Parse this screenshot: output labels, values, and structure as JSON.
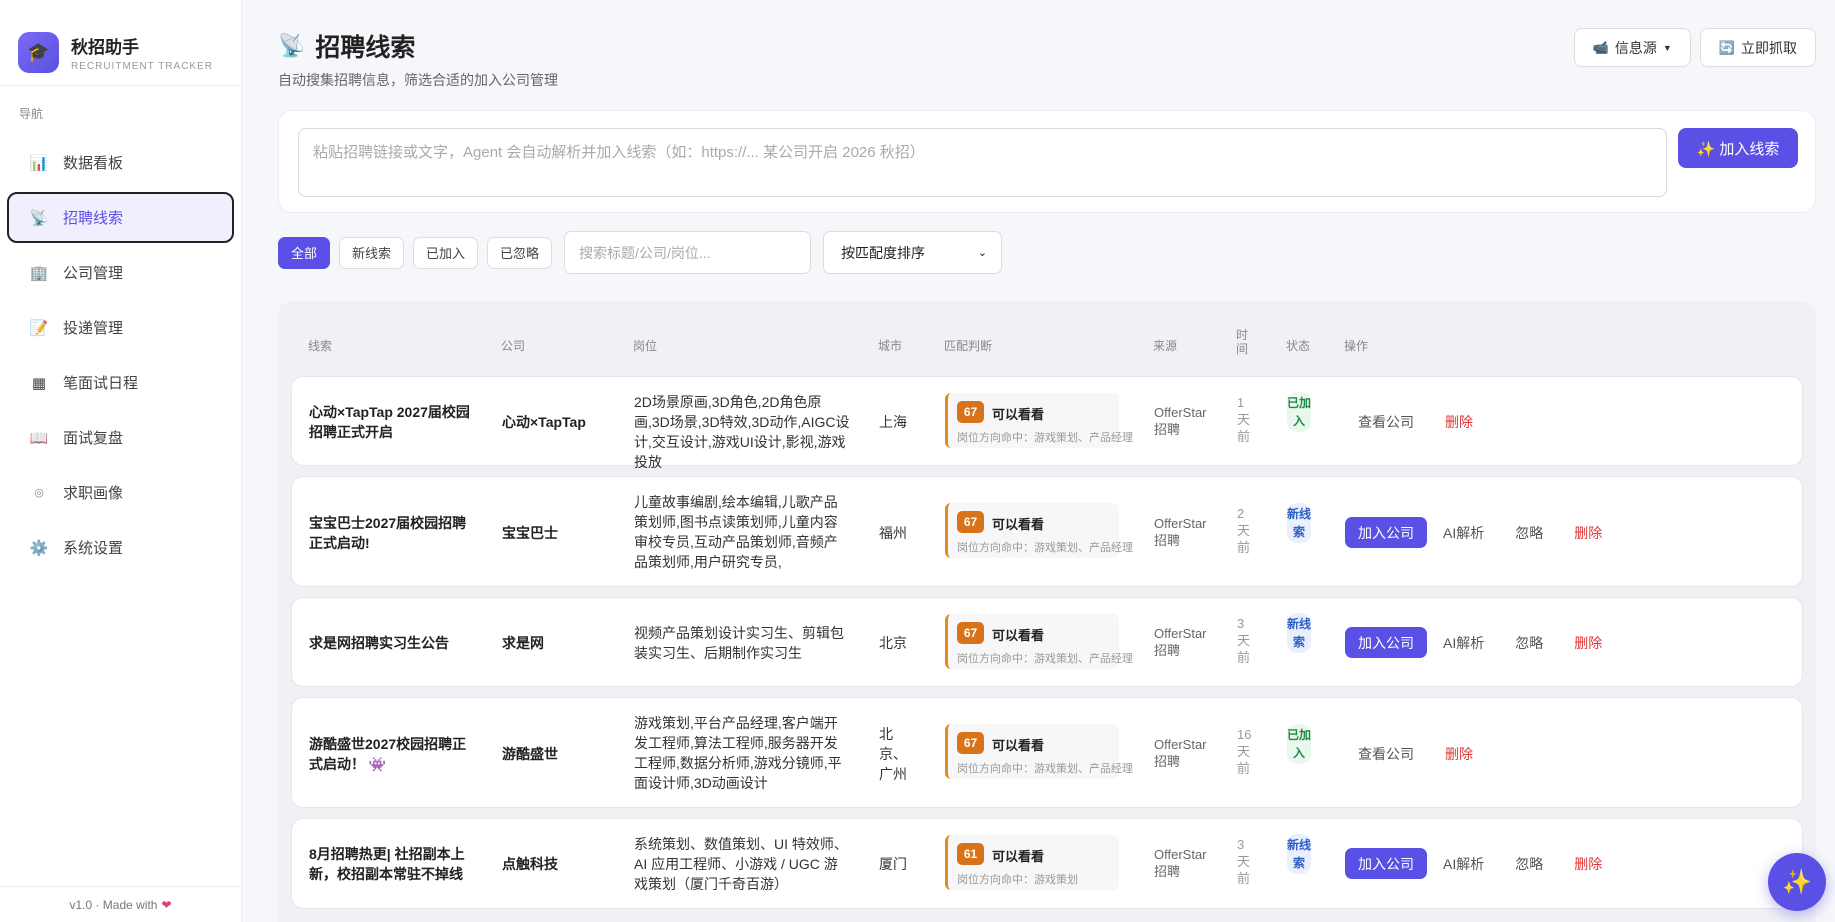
{
  "brand": {
    "title": "秋招助手",
    "subtitle": "RECRUITMENT TRACKER"
  },
  "sidebar": {
    "nav_label": "导航",
    "items": [
      {
        "label": "数据看板",
        "icon": "chart-icon"
      },
      {
        "label": "招聘线索",
        "icon": "satellite-icon",
        "active": true
      },
      {
        "label": "公司管理",
        "icon": "building-icon"
      },
      {
        "label": "投递管理",
        "icon": "memo-icon"
      },
      {
        "label": "笔面试日程",
        "icon": "calendar-grid-icon"
      },
      {
        "label": "面试复盘",
        "icon": "book-icon"
      },
      {
        "label": "求职画像",
        "icon": "target-icon"
      },
      {
        "label": "系统设置",
        "icon": "gear-icon"
      }
    ],
    "footer": "v1.0 · Made with"
  },
  "header": {
    "title": "招聘线索",
    "subtitle": "自动搜集招聘信息，筛选合适的加入公司管理",
    "source_btn": "信息源",
    "fetch_btn": "立即抓取"
  },
  "input": {
    "placeholder": "粘贴招聘链接或文字，Agent 会自动解析并加入线索（如：https://... 某公司开启 2026 秋招）",
    "add_btn": "✨ 加入线索"
  },
  "filters": {
    "chips": [
      "全部",
      "新线索",
      "已加入",
      "已忽略"
    ],
    "search_placeholder": "搜索标题/公司/岗位...",
    "sort_value": "按匹配度排序"
  },
  "table": {
    "headers": [
      "线索",
      "公司",
      "岗位",
      "城市",
      "匹配判断",
      "来源",
      "时间",
      "状态",
      "操作"
    ],
    "rows": [
      {
        "title": "心动×TapTap 2027届校园招聘正式开启",
        "company": "心动×TapTap",
        "position": "2D场景原画,3D角色,2D角色原画,3D场景,3D特效,3D动作,AIGC设计,交互设计,游戏UI设计,影视,游戏投放",
        "city": "上海",
        "score": "67",
        "match": "可以看看",
        "hit": "岗位方向命中：游戏策划、产品经理",
        "source": "OfferStar 招聘",
        "time": "1 天 前",
        "status": "已加入",
        "status_type": "added",
        "actions": [
          "查看公司",
          "删除"
        ]
      },
      {
        "title": "宝宝巴士2027届校园招聘正式启动!",
        "company": "宝宝巴士",
        "position": "儿童故事编剧,绘本编辑,儿歌产品策划师,图书点读策划师,儿童内容审校专员,互动产品策划师,音频产品策划师,用户研究专员,",
        "city": "福州",
        "score": "67",
        "match": "可以看看",
        "hit": "岗位方向命中：游戏策划、产品经理",
        "source": "OfferStar 招聘",
        "time": "2 天 前",
        "status": "新线索",
        "status_type": "new",
        "actions": [
          "加入公司",
          "AI解析",
          "忽略",
          "删除"
        ]
      },
      {
        "title": "求是网招聘实习生公告",
        "company": "求是网",
        "position": "视频产品策划设计实习生、剪辑包装实习生、后期制作实习生",
        "city": "北京",
        "score": "67",
        "match": "可以看看",
        "hit": "岗位方向命中：游戏策划、产品经理",
        "source": "OfferStar 招聘",
        "time": "3 天 前",
        "status": "新线索",
        "status_type": "new",
        "actions": [
          "加入公司",
          "AI解析",
          "忽略",
          "删除"
        ]
      },
      {
        "title": "游酷盛世2027校园招聘正式启动！ 👾",
        "company": "游酷盛世",
        "position": "游戏策划,平台产品经理,客户端开发工程师,算法工程师,服务器开发工程师,数据分析师,游戏分镜师,平面设计师,3D动画设计",
        "city": "北京、广州",
        "score": "67",
        "match": "可以看看",
        "hit": "岗位方向命中：游戏策划、产品经理",
        "source": "OfferStar 招聘",
        "time": "16 天 前",
        "status": "已加入",
        "status_type": "added",
        "actions": [
          "查看公司",
          "删除"
        ]
      },
      {
        "title": "8月招聘热更| 社招副本上新，校招副本常驻不掉线",
        "company": "点触科技",
        "position": "系统策划、数值策划、UI 特效师、AI 应用工程师、小游戏 / UGC 游戏策划（厦门千奇百游）",
        "city": "厦门",
        "score": "61",
        "match": "可以看看",
        "hit": "岗位方向命中：游戏策划",
        "source": "OfferStar 招聘",
        "time": "3 天 前",
        "status": "新线索",
        "status_type": "new",
        "actions": [
          "加入公司",
          "AI解析",
          "忽略",
          "删除"
        ]
      }
    ]
  },
  "fab_icon": "sparkles-icon"
}
